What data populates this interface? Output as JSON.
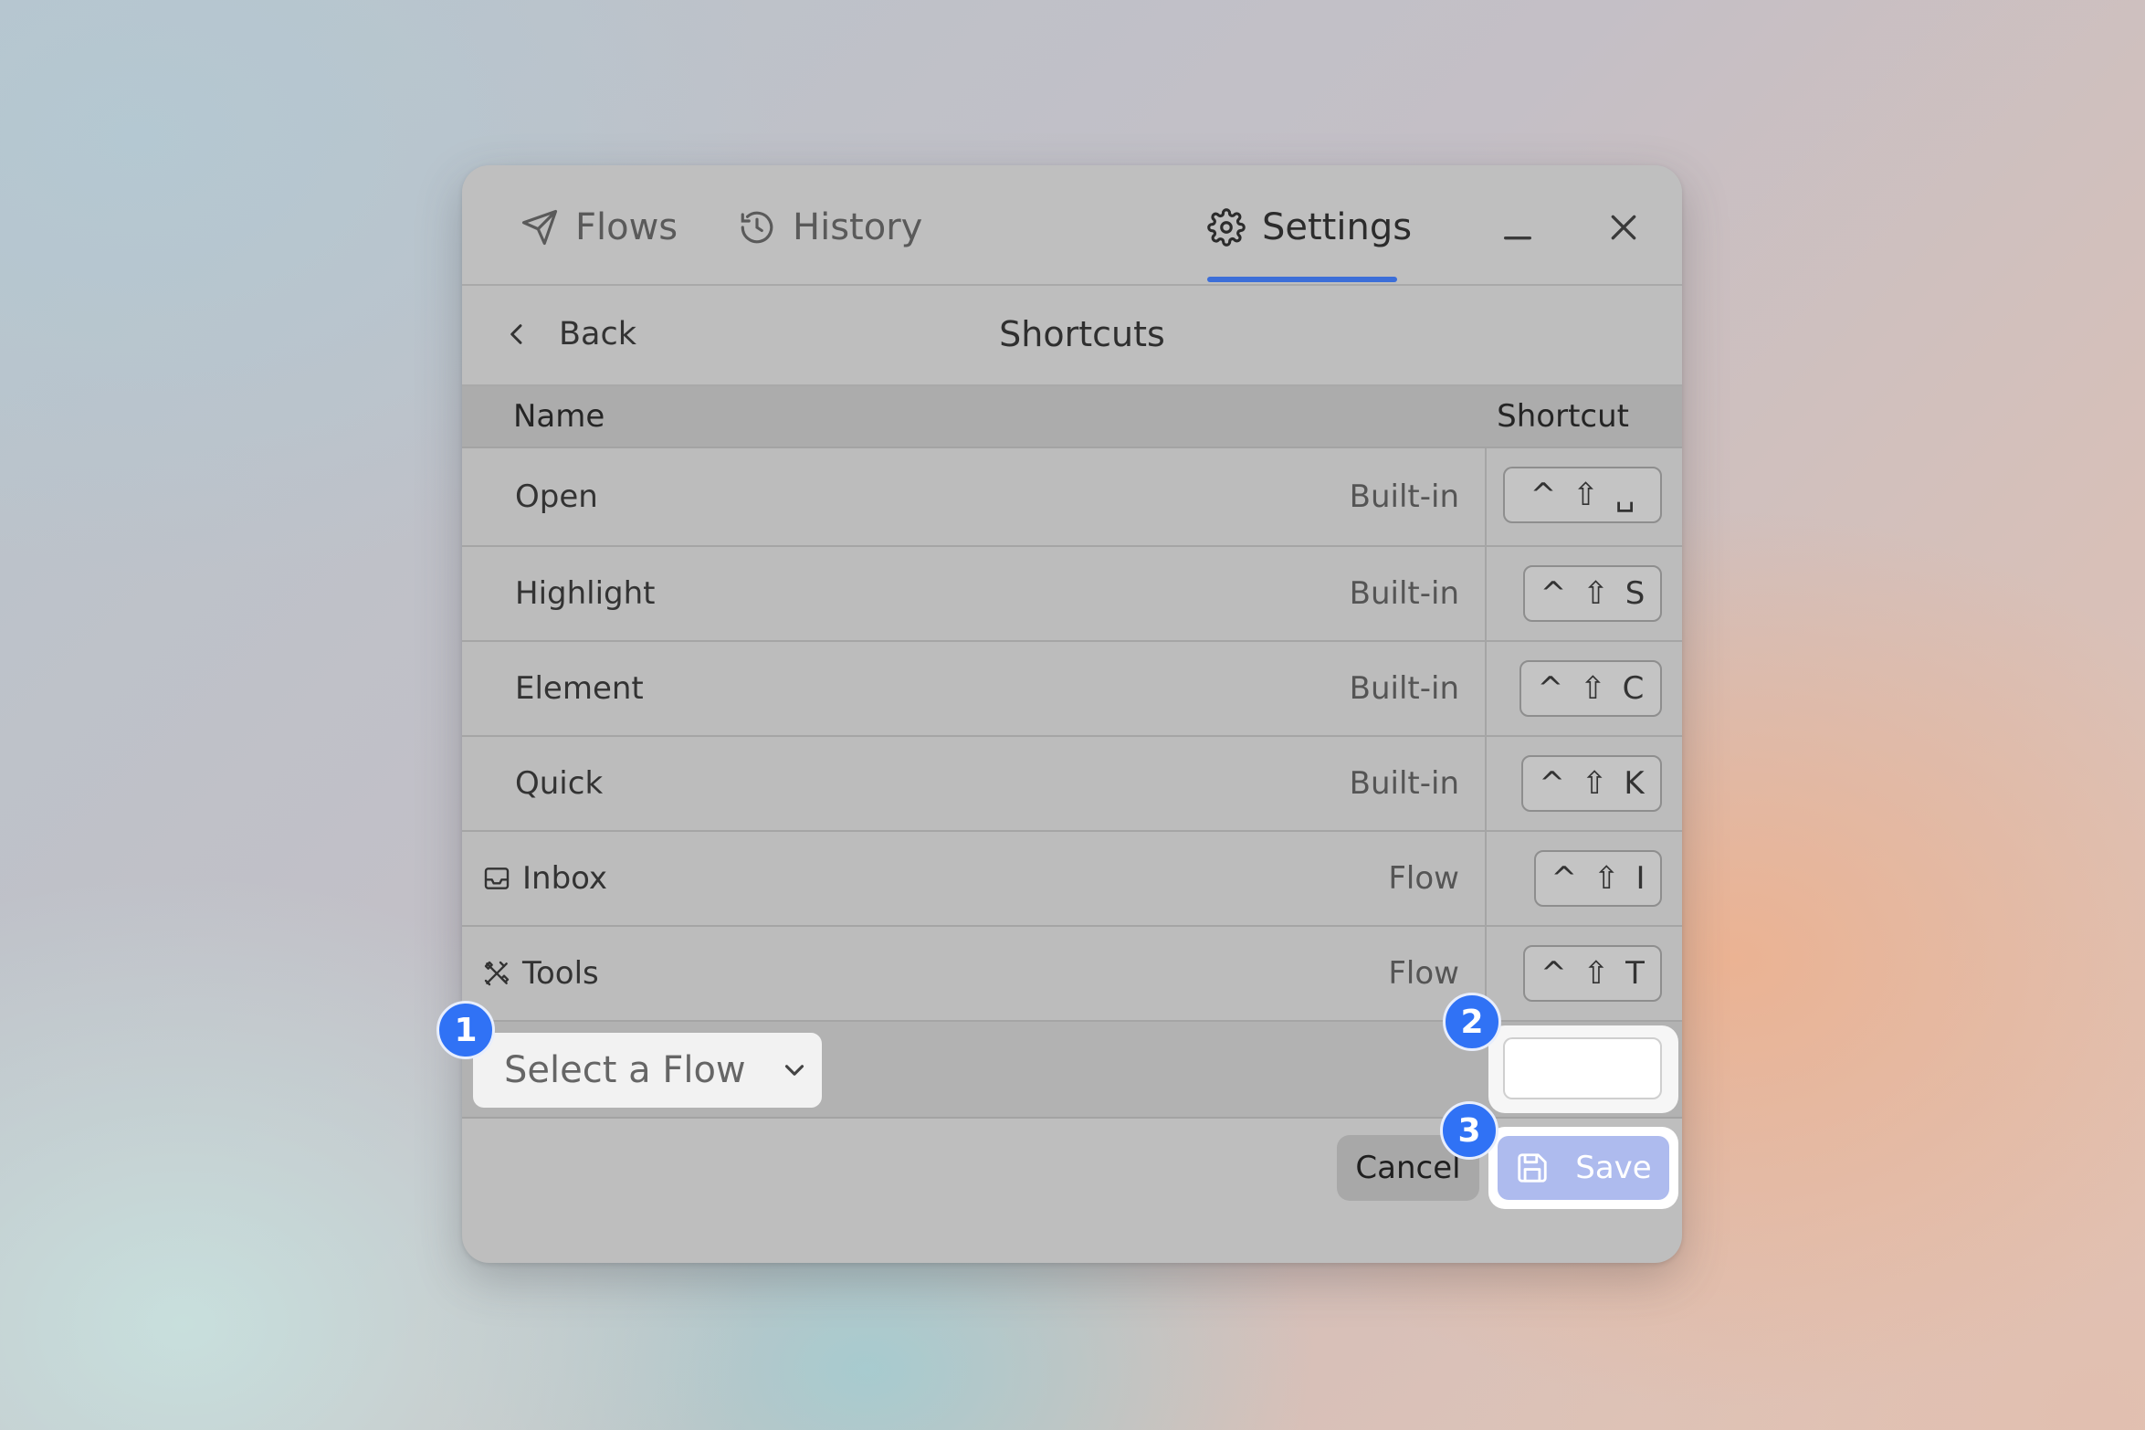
{
  "tabs": [
    {
      "label": "Flows",
      "icon": "send-icon",
      "active": false
    },
    {
      "label": "History",
      "icon": "history-icon",
      "active": false
    },
    {
      "label": "Settings",
      "icon": "gear-icon",
      "active": true
    }
  ],
  "subheader": {
    "back_label": "Back",
    "title": "Shortcuts"
  },
  "table": {
    "columns": {
      "name": "Name",
      "shortcut": "Shortcut"
    },
    "rows": [
      {
        "name": "Open",
        "type": "Built-in",
        "modifiers": [
          "^",
          "⇧"
        ],
        "key": "␣"
      },
      {
        "name": "Highlight",
        "type": "Built-in",
        "modifiers": [
          "^",
          "⇧"
        ],
        "key": "S"
      },
      {
        "name": "Element",
        "type": "Built-in",
        "modifiers": [
          "^",
          "⇧"
        ],
        "key": "C"
      },
      {
        "name": "Quick",
        "type": "Built-in",
        "modifiers": [
          "^",
          "⇧"
        ],
        "key": "K"
      },
      {
        "name": "Inbox",
        "type": "Flow",
        "icon": "inbox-icon",
        "modifiers": [
          "^",
          "⇧"
        ],
        "key": "I"
      },
      {
        "name": "Tools",
        "type": "Flow",
        "icon": "tools-icon",
        "modifiers": [
          "^",
          "⇧"
        ],
        "key": "T"
      }
    ]
  },
  "new_shortcut": {
    "select_placeholder": "Select a Flow",
    "shortcut_value": ""
  },
  "actions": {
    "cancel_label": "Cancel",
    "save_label": "Save"
  },
  "badges": [
    "1",
    "2",
    "3"
  ],
  "colors": {
    "accent": "#3c6ed8",
    "badge": "#3072f5",
    "save_bg": "#aebbee"
  }
}
